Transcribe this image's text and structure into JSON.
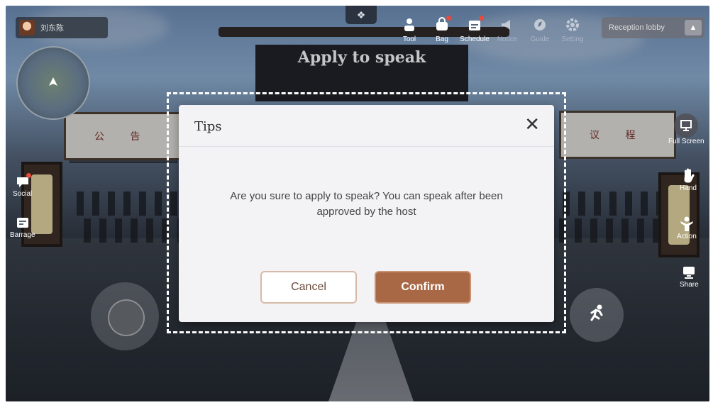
{
  "user": {
    "name": "刘东陈"
  },
  "stage": {
    "title": "Apply to speak"
  },
  "toolbar": {
    "items": [
      {
        "label": "Tool",
        "icon": "person-tool-icon"
      },
      {
        "label": "Bag",
        "icon": "bag-icon",
        "badge": true
      },
      {
        "label": "Schedule",
        "icon": "schedule-icon",
        "badge": true
      },
      {
        "label": "Notice",
        "icon": "megaphone-icon"
      },
      {
        "label": "Guide",
        "icon": "compass-icon"
      },
      {
        "label": "Setting",
        "icon": "gear-icon"
      }
    ]
  },
  "lobby": {
    "label": "Reception lobby"
  },
  "left_buttons": {
    "social": "Social",
    "barrage": "Barrage"
  },
  "right_buttons": {
    "full_screen": "Full Screen",
    "hand": "Hand",
    "action": "Action",
    "share": "Share"
  },
  "scene": {
    "board_left": "公 告",
    "board_right": "议 程"
  },
  "dialog": {
    "title": "Tips",
    "message": "Are you sure to apply to speak? You can speak after been approved by the host",
    "cancel_label": "Cancel",
    "confirm_label": "Confirm"
  },
  "colors": {
    "confirm": "#a86845",
    "cancel_border": "#d8b9a7",
    "badge": "#e54b3f"
  }
}
